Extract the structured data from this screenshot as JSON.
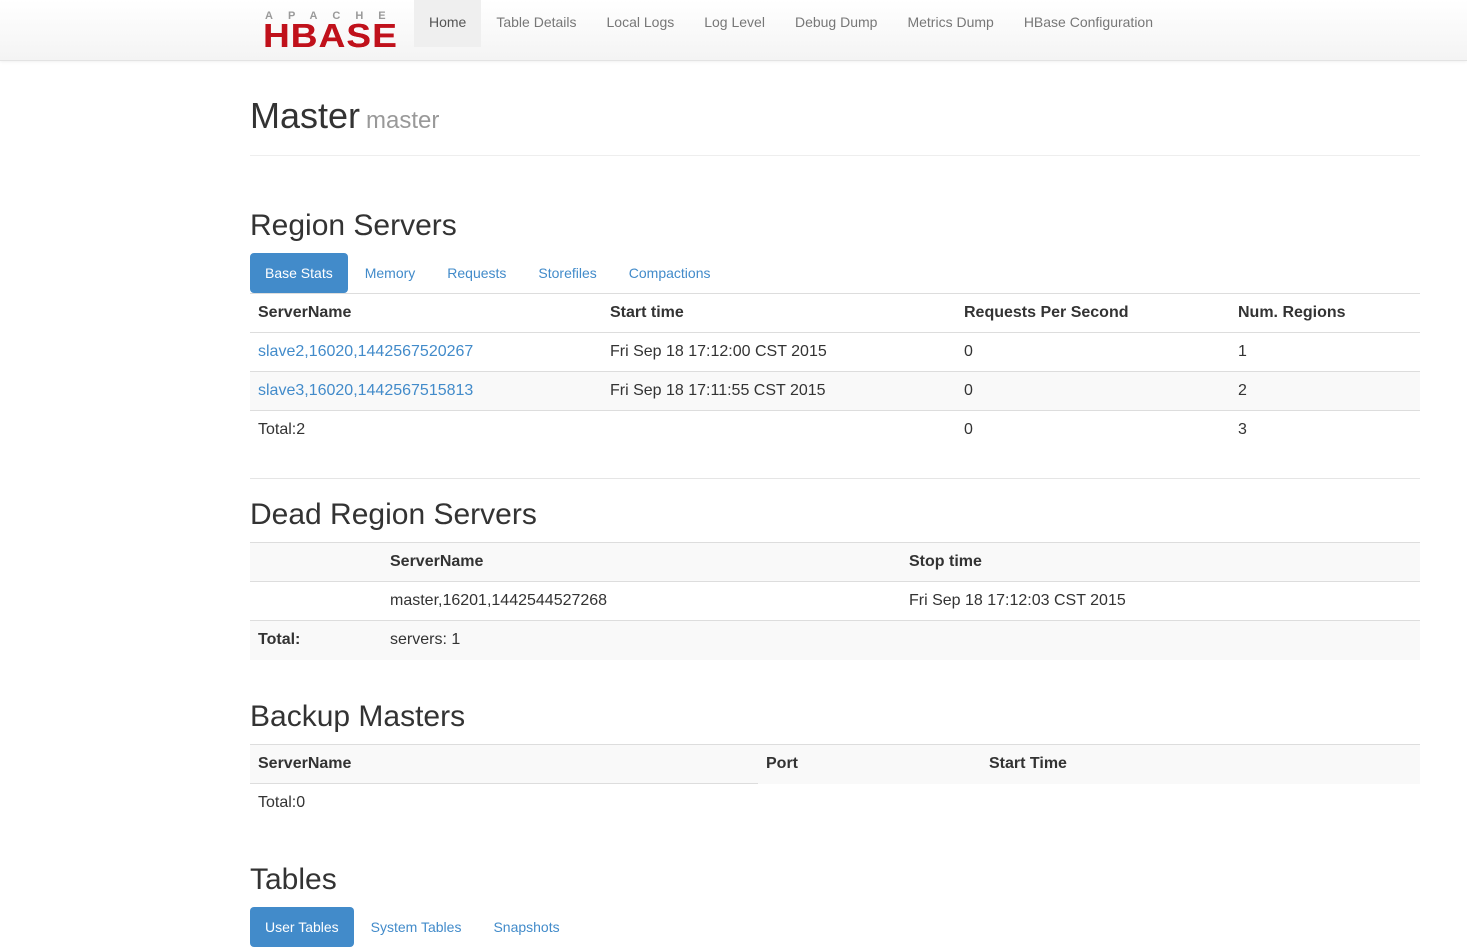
{
  "brand": {
    "top": "APACHE",
    "main": "HBASE",
    "red": "#c0111b"
  },
  "nav": {
    "items": [
      "Home",
      "Table Details",
      "Local Logs",
      "Log Level",
      "Debug Dump",
      "Metrics Dump",
      "HBase Configuration"
    ],
    "active": "Home"
  },
  "header": {
    "title": "Master",
    "subtitle": "master"
  },
  "region_servers": {
    "heading": "Region Servers",
    "tabs": [
      "Base Stats",
      "Memory",
      "Requests",
      "Storefiles",
      "Compactions"
    ],
    "active_tab": "Base Stats",
    "columns": [
      "ServerName",
      "Start time",
      "Requests Per Second",
      "Num. Regions"
    ],
    "rows": [
      [
        "slave2,16020,1442567520267",
        "Fri Sep 18 17:12:00 CST 2015",
        "0",
        "1"
      ],
      [
        "slave3,16020,1442567515813",
        "Fri Sep 18 17:11:55 CST 2015",
        "0",
        "2"
      ]
    ],
    "total": [
      "Total:2",
      "",
      "0",
      "3"
    ]
  },
  "dead_servers": {
    "heading": "Dead Region Servers",
    "columns": [
      "",
      "ServerName",
      "Stop time"
    ],
    "rows": [
      [
        "",
        "master,16201,1442544527268",
        "Fri Sep 18 17:12:03 CST 2015"
      ]
    ],
    "total_label": "Total:",
    "total_value": "servers: 1"
  },
  "backup_masters": {
    "heading": "Backup Masters",
    "columns": [
      "ServerName",
      "Port",
      "Start Time"
    ],
    "total": "Total:0"
  },
  "tables": {
    "heading": "Tables",
    "tabs": [
      "User Tables",
      "System Tables",
      "Snapshots"
    ],
    "active_tab": "User Tables"
  },
  "colors": {
    "link": "#428bca",
    "pill_active_bg": "#428bca",
    "nav_active_bg": "#efefef"
  }
}
